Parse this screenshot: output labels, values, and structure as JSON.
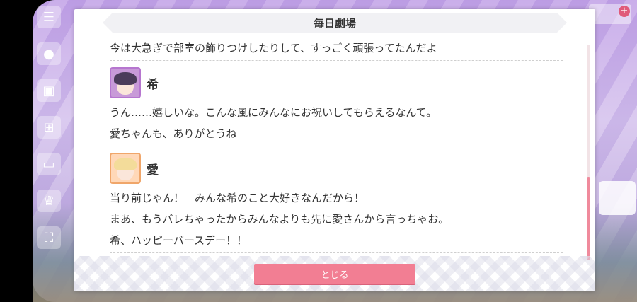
{
  "window": {
    "title": "毎日劇場"
  },
  "dialogue": [
    {
      "type": "line",
      "text": "今は大急ぎで部室の飾りつけしたりして、すっごく頑張ってたんだよ"
    },
    {
      "type": "speaker",
      "name": "希",
      "avatar_icon": "nozomi-avatar-icon"
    },
    {
      "type": "line",
      "text": "うん……嬉しいな。こんな風にみんなにお祝いしてもらえるなんて。"
    },
    {
      "type": "line",
      "text": "愛ちゃんも、ありがとうね"
    },
    {
      "type": "speaker",
      "name": "愛",
      "avatar_icon": "ai-avatar-icon"
    },
    {
      "type": "line",
      "text": "当り前じゃん！　みんな希のこと大好きなんだから！"
    },
    {
      "type": "line",
      "text": "まあ、もうバレちゃったからみんなよりも先に愛さんから言っちゃお。"
    },
    {
      "type": "line",
      "text": "希、ハッピーバースデー！！"
    }
  ],
  "buttons": {
    "close_label": "とじる"
  },
  "colors": {
    "accent": "#f27e93",
    "scrollbar": "#f08a9c"
  },
  "scroll": {
    "position": 1.0
  }
}
